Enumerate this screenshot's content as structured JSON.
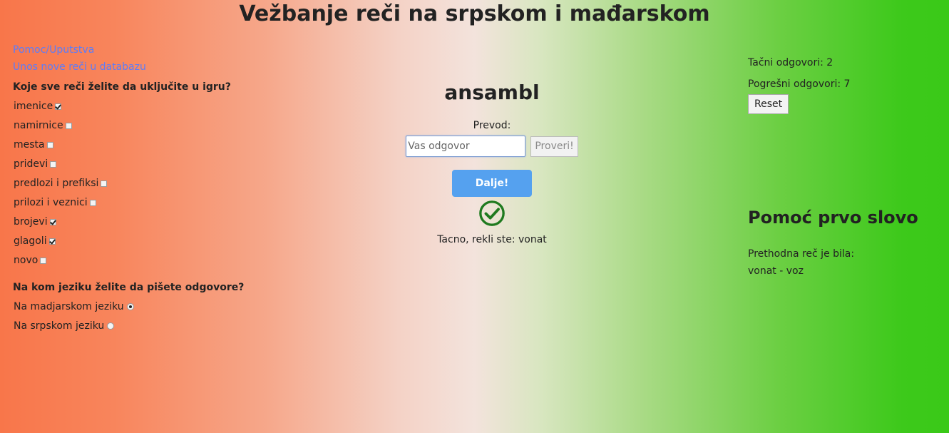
{
  "title": "Vežbanje reči na srpskom i mađarskom",
  "links": {
    "help": "Pomoc/Uputstva",
    "new_word": "Unos nove reči u databazu"
  },
  "categories_heading": "Koje sve reči želite da uključite u igru?",
  "categories": [
    {
      "label": "imenice",
      "checked": true
    },
    {
      "label": "namirnice",
      "checked": false
    },
    {
      "label": "mesta",
      "checked": false
    },
    {
      "label": "pridevi",
      "checked": false
    },
    {
      "label": "predlozi i prefiksi",
      "checked": false
    },
    {
      "label": "prilozi i veznici",
      "checked": false
    },
    {
      "label": "brojevi",
      "checked": true
    },
    {
      "label": "glagoli",
      "checked": true
    },
    {
      "label": "novo",
      "checked": false
    }
  ],
  "language_heading": "Na kom jeziku želite da pišete odgovore?",
  "languages": [
    {
      "label": "Na madjarskom jeziku",
      "selected": true
    },
    {
      "label": "Na srpskom jeziku",
      "selected": false
    }
  ],
  "quiz": {
    "word": "ansambl",
    "prevod_label": "Prevod:",
    "input_value": "",
    "input_placeholder": "Vas odgovor",
    "check_label": "Proveri!",
    "next_label": "Dalje!",
    "feedback": "Tacno, rekli ste: vonat",
    "result_icon": "check-circle-icon",
    "result_color": "#1f7a1f"
  },
  "score": {
    "correct": "Tačni odgovori: 2",
    "wrong": "Pogrešni odgovori: 7",
    "reset_label": "Reset"
  },
  "hint": {
    "heading": "Pomoć prvo slovo",
    "prev_label": "Prethodna reč je bila:",
    "prev_value": "vonat - voz"
  },
  "colors": {
    "link": "#5b7cfa",
    "primary_button": "#55a1ef",
    "gradient_left": "#f8764a",
    "gradient_right": "#3ac918"
  }
}
